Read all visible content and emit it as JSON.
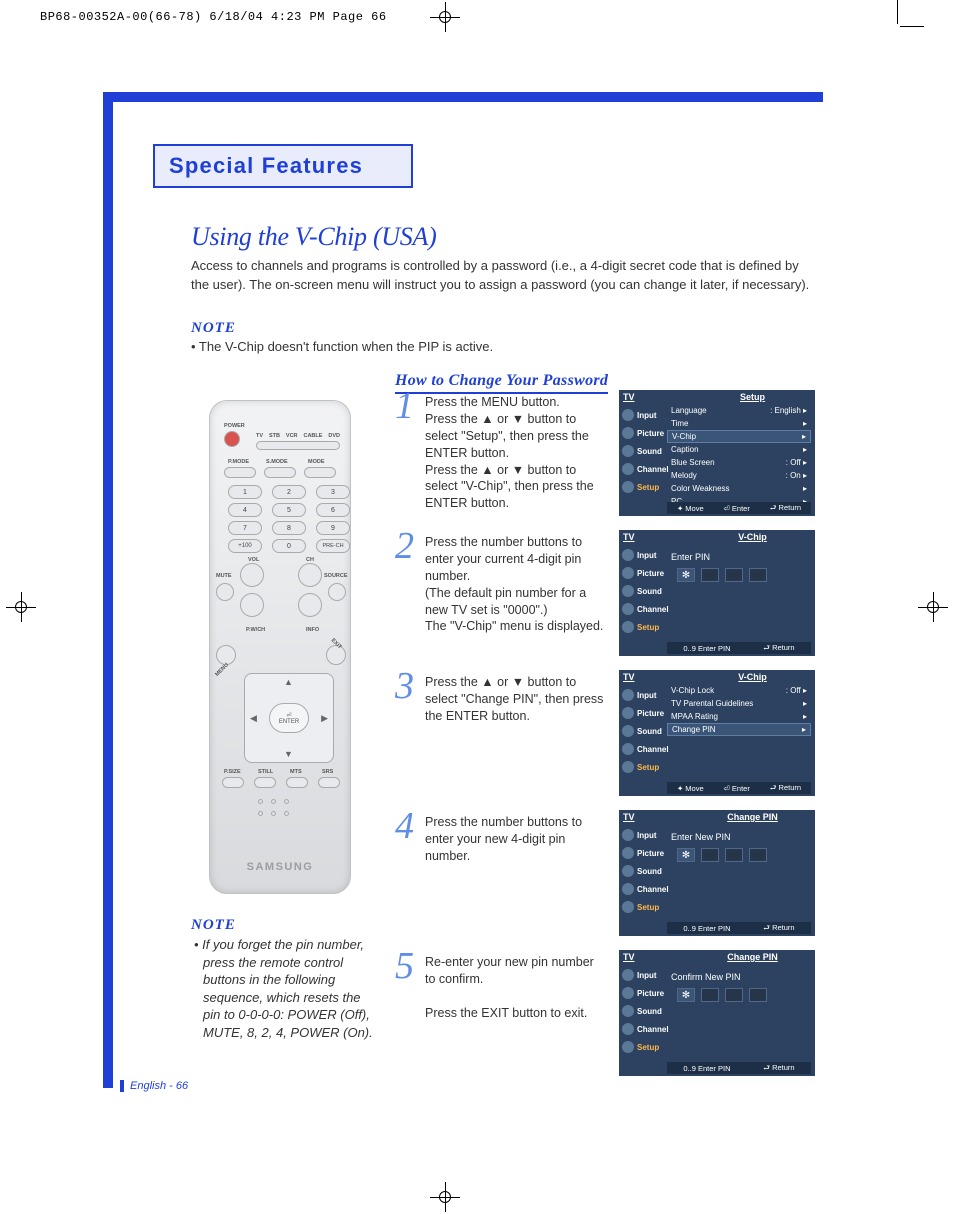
{
  "slug": "BP68-00352A-00(66-78)  6/18/04  4:23 PM  Page 66",
  "chapter": "Special Features",
  "section_title": "Using the V-Chip  (USA)",
  "intro": "Access to channels and programs is controlled by a password (i.e., a 4-digit secret code that is defined by the user). The on-screen menu will instruct you to assign a password (you can change it later, if necessary).",
  "note_label": "NOTE",
  "note1": "• The V-Chip doesn't function when the PIP is active.",
  "subheading": "How to Change Your Password",
  "remote_brand": "SAMSUNG",
  "note2": "• If you forget the pin number, press the remote control buttons in the following sequence, which resets the pin to 0-0-0-0: POWER (Off), MUTE, 8, 2, 4, POWER (On).",
  "footer": "English - 66",
  "side_menu": [
    "Input",
    "Picture",
    "Sound",
    "Channel",
    "Setup"
  ],
  "osd_tv": "TV",
  "steps": [
    {
      "num": "1",
      "text": "Press the MENU button.\nPress the ▲ or ▼ button to select \"Setup\", then press the ENTER button.\nPress the ▲ or ▼ button to select \"V-Chip\", then press the ENTER button.",
      "osd": {
        "title": "Setup",
        "rows": [
          {
            "l": "Language",
            "r": ": English",
            "a": true
          },
          {
            "l": "Time",
            "r": "",
            "a": true
          },
          {
            "l": "V-Chip",
            "r": "",
            "a": true,
            "hl": true
          },
          {
            "l": "Caption",
            "r": "",
            "a": true
          },
          {
            "l": "Blue Screen",
            "r": ": Off",
            "a": true
          },
          {
            "l": "Melody",
            "r": ": On",
            "a": true
          },
          {
            "l": "Color Weakness",
            "r": "",
            "a": true
          },
          {
            "l": "PC",
            "r": "",
            "a": true
          }
        ],
        "foot": [
          "✦ Move",
          "⏎ Enter",
          "⮐ Return"
        ]
      }
    },
    {
      "num": "2",
      "text": "Press the number buttons to enter your current 4-digit pin number.\n(The default pin number for a new TV set is \"0000\".)\nThe \"V-Chip\" menu is displayed.",
      "osd": {
        "title": "V-Chip",
        "pin_label": "Enter PIN",
        "foot": [
          "0..9 Enter PIN",
          "⮐ Return"
        ]
      }
    },
    {
      "num": "3",
      "text": "Press the ▲ or ▼ button to select \"Change PIN\", then press the ENTER button.",
      "osd": {
        "title": "V-Chip",
        "rows": [
          {
            "l": "V-Chip Lock",
            "r": ": Off",
            "a": true
          },
          {
            "l": "TV Parental Guidelines",
            "r": "",
            "a": true
          },
          {
            "l": "MPAA Rating",
            "r": "",
            "a": true
          },
          {
            "l": "Change PIN",
            "r": "",
            "a": true,
            "hl": true
          }
        ],
        "foot": [
          "✦ Move",
          "⏎ Enter",
          "⮐ Return"
        ]
      }
    },
    {
      "num": "4",
      "text": "Press the number buttons to enter your new 4-digit pin number.",
      "osd": {
        "title": "Change PIN",
        "pin_label": "Enter New PIN",
        "foot": [
          "0..9 Enter PIN",
          "⮐ Return"
        ]
      }
    },
    {
      "num": "5",
      "text": "Re-enter your new pin number to confirm.\n\nPress the EXIT button to exit.",
      "osd": {
        "title": "Change PIN",
        "pin_label": "Confirm New PIN",
        "foot": [
          "0..9 Enter PIN",
          "⮐ Return"
        ]
      }
    }
  ]
}
